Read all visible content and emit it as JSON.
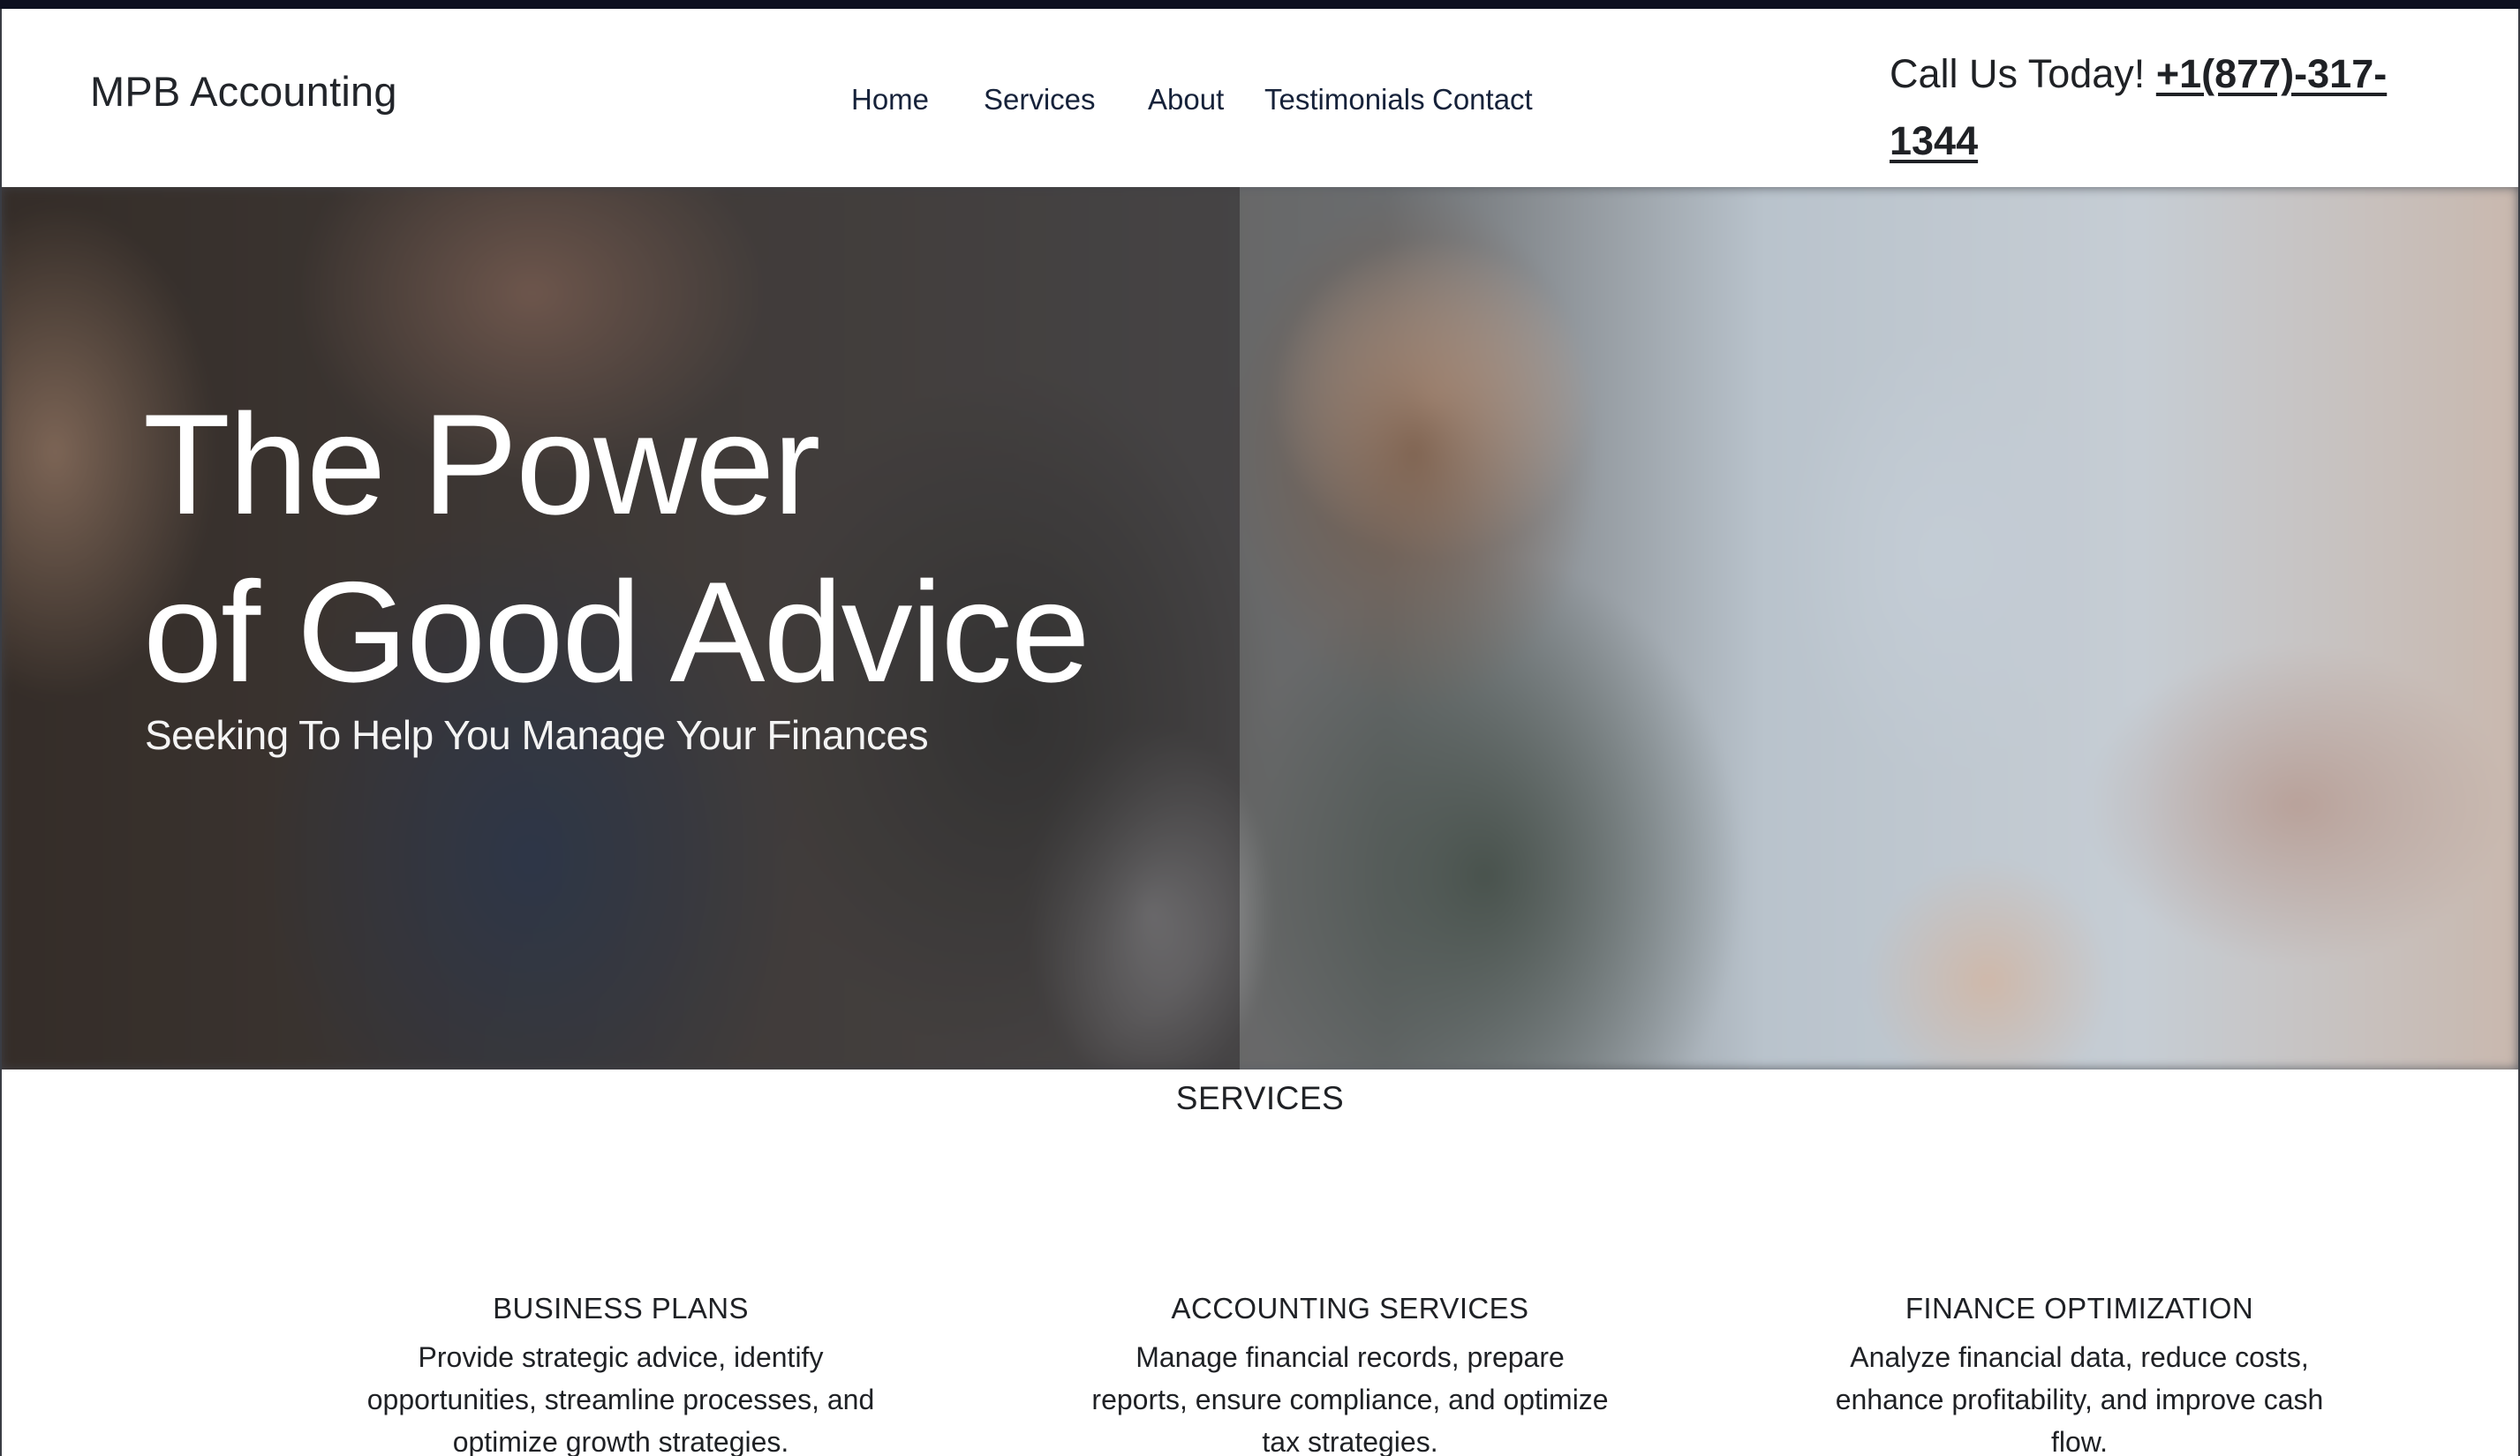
{
  "header": {
    "brand": "MPB Accounting",
    "nav": [
      "Home",
      "Services",
      "About",
      "Testimonials",
      "Contact"
    ],
    "call_label": "Call Us Today!",
    "phone": "+1(877)-317-1344"
  },
  "hero": {
    "title_line1": "The Power",
    "title_line2": "of Good Advice",
    "subtitle": "Seeking To Help You Manage Your Finances"
  },
  "services": {
    "heading": "SERVICES",
    "items": [
      {
        "title": "BUSINESS PLANS",
        "description": "Provide strategic advice, identify opportunities, streamline processes, and optimize growth strategies."
      },
      {
        "title": "ACCOUNTING SERVICES",
        "description": "Manage financial records, prepare reports, ensure compliance, and optimize tax strategies."
      },
      {
        "title": "FINANCE OPTIMIZATION",
        "description": "Analyze financial data, reduce costs, enhance profitability, and improve cash flow."
      }
    ]
  }
}
